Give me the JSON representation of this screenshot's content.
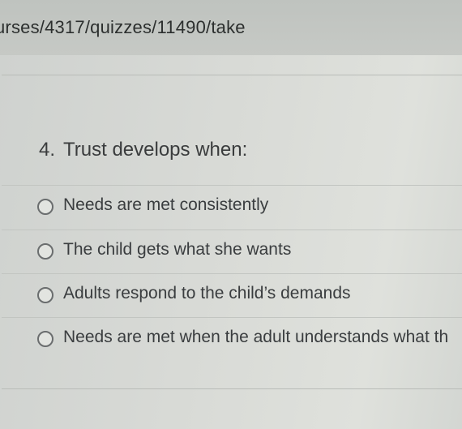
{
  "browser": {
    "url": "urses/4317/quizzes/11490/take"
  },
  "quiz": {
    "question_number": "4.",
    "question_text": "Trust develops when:",
    "options": [
      {
        "label": "Needs are met consistently"
      },
      {
        "label": "The child gets what she wants"
      },
      {
        "label": "Adults respond to the child’s demands"
      },
      {
        "label": "Needs are met when the adult understands what th"
      }
    ]
  }
}
